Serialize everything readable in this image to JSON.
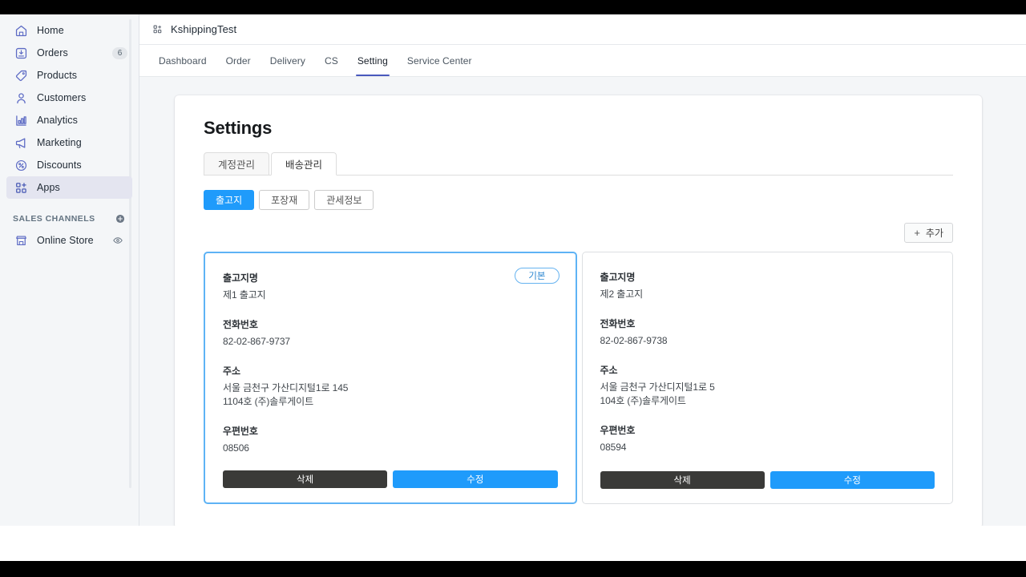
{
  "sidebar": {
    "items": [
      {
        "label": "Home",
        "icon": "home-icon",
        "badge": null,
        "active": false
      },
      {
        "label": "Orders",
        "icon": "orders-icon",
        "badge": "6",
        "active": false
      },
      {
        "label": "Products",
        "icon": "products-icon",
        "badge": null,
        "active": false
      },
      {
        "label": "Customers",
        "icon": "customers-icon",
        "badge": null,
        "active": false
      },
      {
        "label": "Analytics",
        "icon": "analytics-icon",
        "badge": null,
        "active": false
      },
      {
        "label": "Marketing",
        "icon": "marketing-icon",
        "badge": null,
        "active": false
      },
      {
        "label": "Discounts",
        "icon": "discounts-icon",
        "badge": null,
        "active": false
      },
      {
        "label": "Apps",
        "icon": "apps-icon",
        "badge": null,
        "active": true
      }
    ],
    "sales_channels": {
      "title": "SALES CHANNELS",
      "add_icon": "plus-circle-icon",
      "items": [
        {
          "label": "Online Store",
          "icon": "store-icon",
          "trailing_icon": "eye-icon"
        }
      ]
    }
  },
  "appbar": {
    "icon": "apps-grid-icon",
    "title": "KshippingTest"
  },
  "nav_tabs": [
    {
      "label": "Dashboard",
      "active": false
    },
    {
      "label": "Order",
      "active": false
    },
    {
      "label": "Delivery",
      "active": false
    },
    {
      "label": "CS",
      "active": false
    },
    {
      "label": "Setting",
      "active": true
    },
    {
      "label": "Service Center",
      "active": false
    }
  ],
  "page": {
    "title": "Settings",
    "tabs": [
      {
        "label": "계정관리",
        "active": false
      },
      {
        "label": "배송관리",
        "active": true
      }
    ],
    "sub_tabs": [
      {
        "label": "출고지",
        "active": true
      },
      {
        "label": "포장재",
        "active": false
      },
      {
        "label": "관세정보",
        "active": false
      }
    ],
    "add_button": {
      "label": "추가",
      "icon": "plus-icon"
    },
    "field_labels": {
      "name": "출고지명",
      "phone": "전화번호",
      "address": "주소",
      "zipcode": "우편번호"
    },
    "actions": {
      "delete": "삭제",
      "edit": "수정"
    },
    "default_chip": "기본",
    "cards": [
      {
        "selected": true,
        "is_default": true,
        "name": "제1 출고지",
        "phone": "82-02-867-9737",
        "address_line1": "서울 금천구 가산디지털1로 145",
        "address_line2": "1104호 (주)솔루게이트",
        "zipcode": "08506"
      },
      {
        "selected": false,
        "is_default": false,
        "name": "제2 출고지",
        "phone": "82-02-867-9738",
        "address_line1": "서울 금천구 가산디지털1로 5",
        "address_line2": "104호 (주)솔루게이트",
        "zipcode": "08594"
      }
    ]
  },
  "colors": {
    "accent_blue": "#1f9bfb",
    "tab_underline": "#4959bd",
    "selected_border": "#5eb3f5",
    "delete_dark": "#3a3a38",
    "sidebar_active_bg": "#e4e5f0"
  }
}
